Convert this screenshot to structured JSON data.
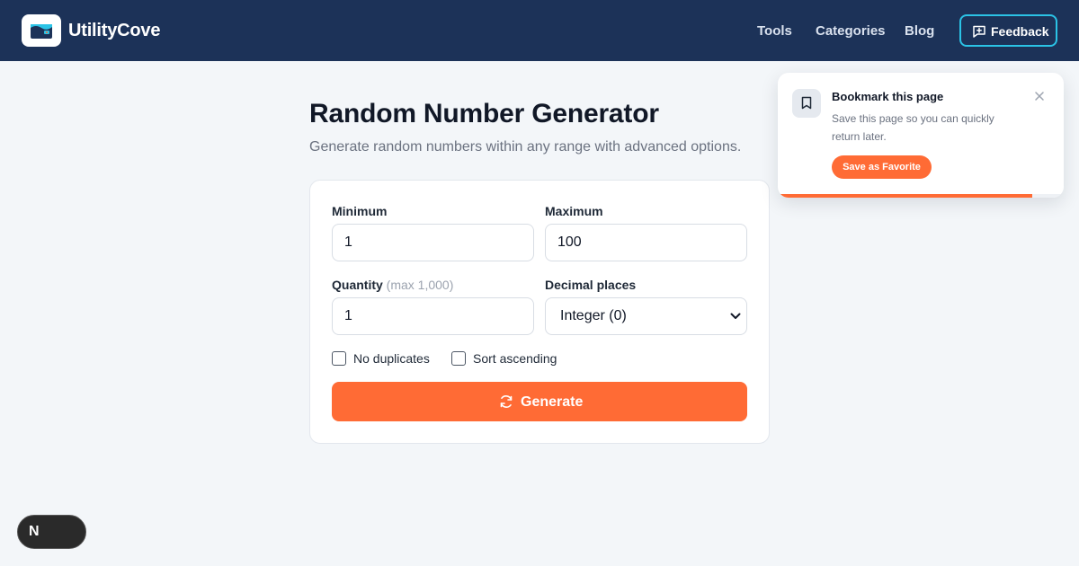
{
  "header": {
    "brand": "UtilityCove",
    "nav": [
      "Tools",
      "Categories",
      "Blog"
    ],
    "feedback_label": "Feedback",
    "colors": {
      "bar": "#1c3258",
      "feedback_border": "#2bc3e6"
    }
  },
  "main": {
    "title": "Random Number Generator",
    "subtitle": "Generate random numbers within any range with advanced options.",
    "form": {
      "min_label": "Minimum",
      "min_value": "1",
      "max_label": "Maximum",
      "max_value": "100",
      "qty_label": "Quantity",
      "qty_hint": "(max 1,000)",
      "qty_value": "1",
      "decimals_label": "Decimal places",
      "decimals_selected": "Integer (0)",
      "no_duplicates_label": "No duplicates",
      "no_duplicates_checked": false,
      "sort_label": "Sort ascending",
      "sort_checked": false,
      "generate_label": "Generate"
    },
    "colors": {
      "accent": "#ff6b35"
    }
  },
  "toast": {
    "title": "Bookmark this page",
    "message": "Save this page so you can quickly return later.",
    "action_label": "Save as Favorite",
    "progress": 0.89,
    "icons": [
      "bookmark-icon",
      "close-icon"
    ]
  },
  "dev_badge": {
    "label": "N"
  }
}
